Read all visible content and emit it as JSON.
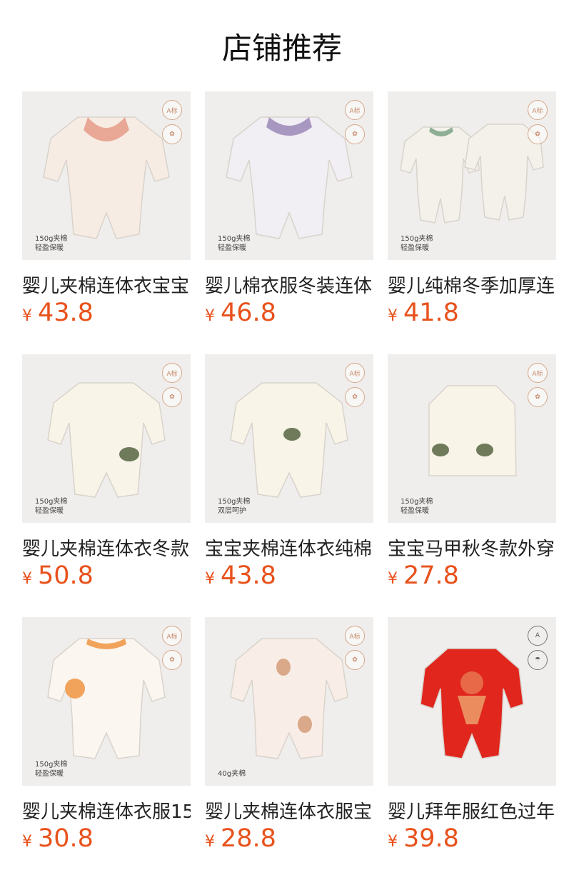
{
  "header": {
    "title": "店铺推荐"
  },
  "currency": "¥",
  "colors": {
    "price": "#e8521c",
    "background": "#efeeec"
  },
  "products": [
    {
      "name": "婴儿夹棉连体衣宝宝",
      "price": "43.8",
      "badge1": "A标",
      "badge2": "✿",
      "caption1": "150g夹棉",
      "caption2": "轻盈保暖",
      "garment": "#f7ece4",
      "accent": "#e9a796"
    },
    {
      "name": "婴儿棉衣服冬装连体",
      "price": "46.8",
      "badge1": "A标",
      "badge2": "✿",
      "caption1": "150g夹棉",
      "caption2": "轻盈保暖",
      "garment": "#f1eef4",
      "accent": "#a897c0"
    },
    {
      "name": "婴儿纯棉冬季加厚连",
      "price": "41.8",
      "badge1": "A标",
      "badge2": "✿",
      "caption1": "150g夹棉",
      "caption2": "轻盈保暖",
      "garment": "#f3f1ea",
      "accent": "#8fae96"
    },
    {
      "name": "婴儿夹棉连体衣冬款",
      "price": "50.8",
      "badge1": "A标",
      "badge2": "✿",
      "caption1": "150g夹棉",
      "caption2": "轻盈保暖",
      "garment": "#f8f4e8",
      "accent": "#6e7a5a"
    },
    {
      "name": "宝宝夹棉连体衣纯棉",
      "price": "43.8",
      "badge1": "A标",
      "badge2": "✿",
      "caption1": "150g夹棉",
      "caption2": "双层呵护",
      "garment": "#f8f4e8",
      "accent": "#6e7a5a"
    },
    {
      "name": "宝宝马甲秋冬款外穿",
      "price": "27.8",
      "badge1": "A标",
      "badge2": "✿",
      "caption1": "150g夹棉",
      "caption2": "轻盈保暖",
      "garment": "#f8f4e8",
      "accent": "#6e7a5a"
    },
    {
      "name": "婴儿夹棉连体衣服15",
      "price": "30.8",
      "badge1": "A标",
      "badge2": "✿",
      "caption1": "150g夹棉",
      "caption2": "轻盈保暖",
      "garment": "#fbf6ef",
      "accent": "#f1a35b"
    },
    {
      "name": "婴儿夹棉连体衣服宝",
      "price": "28.8",
      "badge1": "A标",
      "badge2": "✿",
      "caption1": "40g夹棉",
      "caption2": "",
      "garment": "#f9eee7",
      "accent": "#d9a98a"
    },
    {
      "name": "婴儿拜年服红色过年",
      "price": "39.8",
      "badge1": "A",
      "badge2": "☂",
      "caption1": "",
      "caption2": "",
      "garment": "#e0261d",
      "accent": "#f2d08a"
    }
  ]
}
